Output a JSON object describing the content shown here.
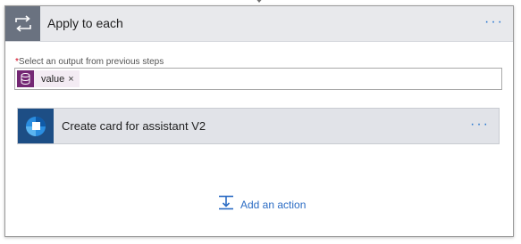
{
  "loop": {
    "title": "Apply to each",
    "more_label": "···",
    "icon": "loop-icon"
  },
  "field": {
    "required_mark": "*",
    "label": "Select an output from previous steps"
  },
  "token": {
    "text": "value",
    "close": "×",
    "icon": "database-icon"
  },
  "inner_action": {
    "title": "Create card for assistant V2",
    "more_label": "···",
    "icon": "assistant-icon"
  },
  "add_action": {
    "label": "Add an action",
    "icon": "add-action-icon"
  },
  "colors": {
    "header_bg": "#e8e9ec",
    "loop_icon_bg": "#6a7280",
    "token_icon_bg": "#742774",
    "inner_icon_bg": "#1d4e85",
    "link": "#2b6cc4"
  }
}
